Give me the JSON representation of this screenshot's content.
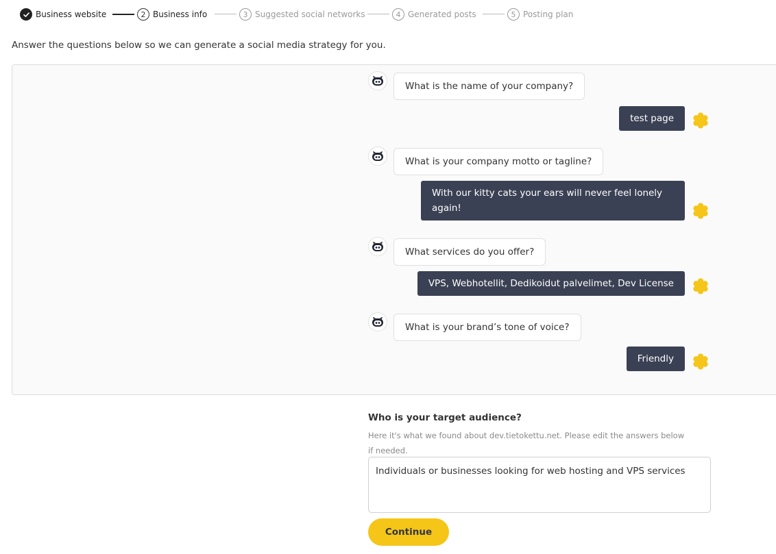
{
  "stepper": {
    "steps": [
      {
        "number": "",
        "label": "Business website",
        "state": "done"
      },
      {
        "number": "2",
        "label": "Business info",
        "state": "active"
      },
      {
        "number": "3",
        "label": "Suggested social networks",
        "state": "pending"
      },
      {
        "number": "4",
        "label": "Generated posts",
        "state": "pending"
      },
      {
        "number": "5",
        "label": "Posting plan",
        "state": "pending"
      }
    ]
  },
  "intro": "Answer the questions below so we can generate a social media strategy for you.",
  "chat": {
    "messages": [
      {
        "question": "What is the name of your company?",
        "answer": "test page"
      },
      {
        "question": "What is your company motto or tagline?",
        "answer": "With our kitty cats your ears will never feel lonely again!"
      },
      {
        "question": "What services do you offer?",
        "answer": "VPS, Webhotellit, Dedikoidut palvelimet, Dev License"
      },
      {
        "question": "What is your brand’s tone of voice?",
        "answer": "Friendly"
      }
    ],
    "bot_icon": "robot-face-icon",
    "user_icon": "honeycomb-avatar-icon"
  },
  "form": {
    "question": "Who is your target audience?",
    "hint": "Here it's what we found about dev.tietokettu.net. Please edit the answers below if needed.",
    "answer_value": "Individuals or businesses looking for web hosting and VPS services",
    "continue_label": "Continue"
  },
  "colors": {
    "accent": "#f5c518",
    "user_bubble": "#3b4154",
    "avatar_yellow": "#f5c518"
  }
}
